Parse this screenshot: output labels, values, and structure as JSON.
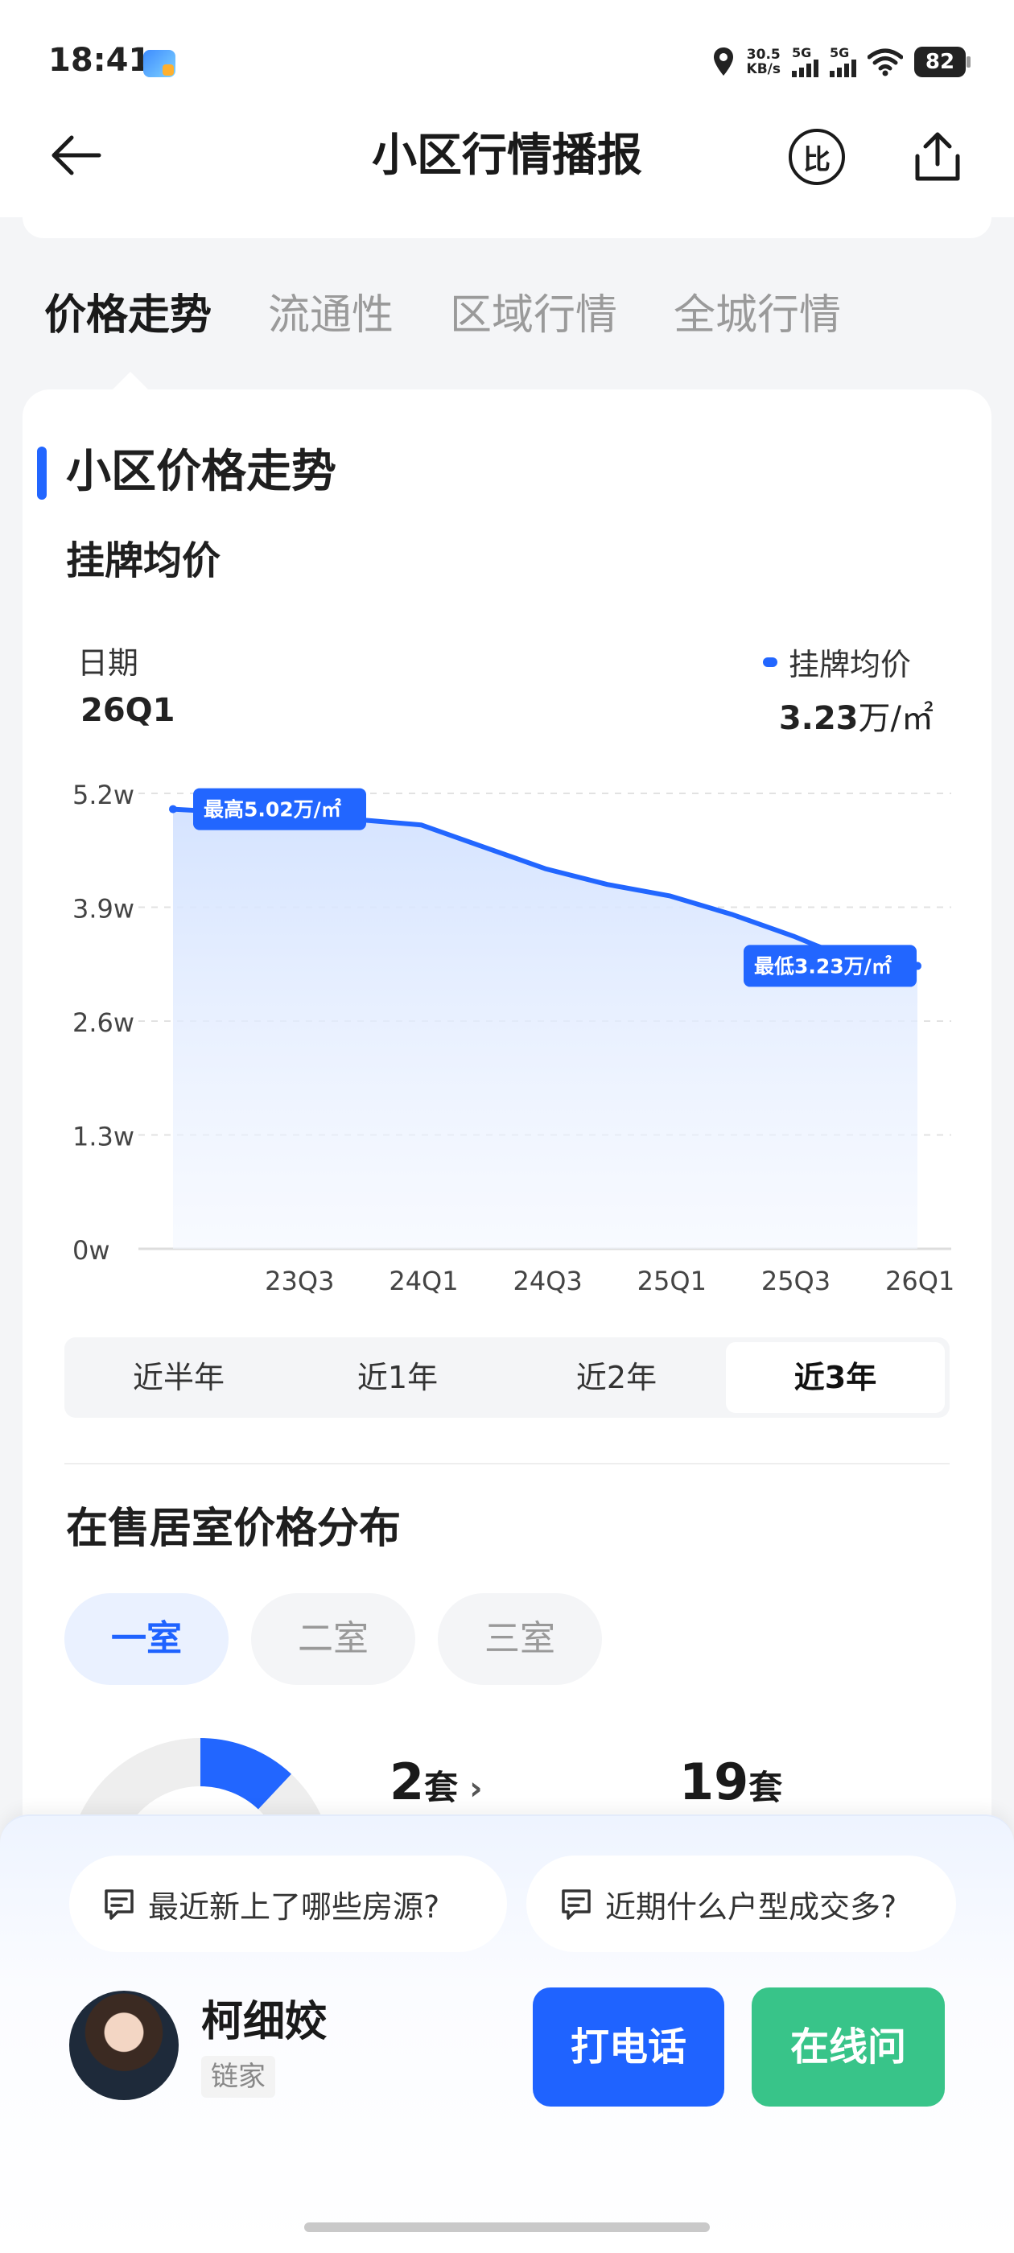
{
  "status_bar": {
    "time": "18:41",
    "net_speed_value": "30.5",
    "net_speed_unit": "KB/s",
    "signal1_label": "5G",
    "signal2_label": "5G",
    "battery": "82"
  },
  "header": {
    "title": "小区行情播报",
    "compare_label": "比"
  },
  "tabs": [
    {
      "label": "价格走势",
      "active": true
    },
    {
      "label": "流通性",
      "active": false
    },
    {
      "label": "区域行情",
      "active": false
    },
    {
      "label": "全城行情",
      "active": false
    }
  ],
  "section": {
    "title": "小区价格走势",
    "subtitle": "挂牌均价",
    "date_label": "日期",
    "date_value": "26Q1",
    "legend_label": "挂牌均价",
    "price_value": "3.23",
    "price_unit": "万/㎡"
  },
  "chart_data": {
    "type": "area",
    "series": [
      {
        "name": "挂牌均价",
        "x": [
          "23Q1",
          "23Q2",
          "23Q3",
          "23Q4",
          "24Q1",
          "24Q2",
          "24Q3",
          "24Q4",
          "25Q1",
          "25Q2",
          "25Q3",
          "25Q4",
          "26Q1"
        ],
        "values": [
          5.02,
          4.98,
          4.94,
          4.9,
          4.84,
          4.59,
          4.34,
          4.16,
          4.03,
          3.82,
          3.57,
          3.28,
          3.23
        ]
      }
    ],
    "x_tick_labels": [
      "23Q3",
      "24Q1",
      "24Q3",
      "25Q1",
      "25Q3",
      "26Q1"
    ],
    "y_tick_labels": [
      "0w",
      "1.3w",
      "2.6w",
      "3.9w",
      "5.2w"
    ],
    "y_ticks": [
      0,
      1.3,
      2.6,
      3.9,
      5.2
    ],
    "ylim": [
      0,
      5.2
    ],
    "max_label": "最高5.02万/㎡",
    "min_label": "最低3.23万/㎡",
    "grid": true,
    "color": "#2266ff"
  },
  "period_selector": [
    {
      "label": "近半年",
      "active": false
    },
    {
      "label": "近1年",
      "active": false
    },
    {
      "label": "近2年",
      "active": false
    },
    {
      "label": "近3年",
      "active": true
    }
  ],
  "distribution": {
    "title": "在售居室价格分布",
    "room_tabs": [
      {
        "label": "一室",
        "active": true
      },
      {
        "label": "二室",
        "active": false
      },
      {
        "label": "三室",
        "active": false
      }
    ],
    "stat1_value": "2",
    "stat1_unit": "套",
    "stat2_value": "19",
    "stat2_unit": "套",
    "donut_fraction": 0.12
  },
  "bottom_sheet": {
    "question1": "最近新上了哪些房源?",
    "question2": "近期什么户型成交多?",
    "agent_name": "柯细姣",
    "agent_company": "链家",
    "call_label": "打电话",
    "chat_label": "在线问"
  },
  "colors": {
    "accent": "#1f63ff",
    "chat_green": "#38c489"
  }
}
